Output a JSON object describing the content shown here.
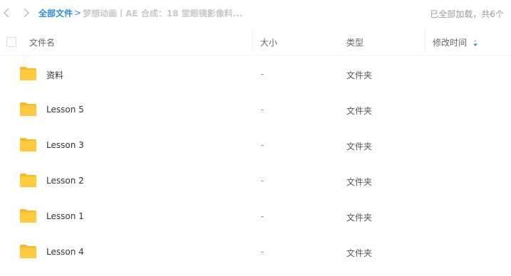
{
  "breadcrumb": {
    "root": "全部文件",
    "separator": ">",
    "current": "梦想动画丨AE 合成：18 堂眼镜影像料..."
  },
  "status": "已全部加载，共6个",
  "columns": {
    "name": "文件名",
    "size": "大小",
    "type": "类型",
    "modified": "修改时间"
  },
  "files": [
    {
      "name": "资料",
      "size": "-",
      "type": "文件夹",
      "icon": "folder-icon"
    },
    {
      "name": "Lesson 5",
      "size": "-",
      "type": "文件夹",
      "icon": "folder-icon"
    },
    {
      "name": "Lesson 3",
      "size": "-",
      "type": "文件夹",
      "icon": "folder-icon"
    },
    {
      "name": "Lesson 2",
      "size": "-",
      "type": "文件夹",
      "icon": "folder-icon"
    },
    {
      "name": "Lesson 1",
      "size": "-",
      "type": "文件夹",
      "icon": "folder-icon"
    },
    {
      "name": "Lesson 4",
      "size": "-",
      "type": "文件夹",
      "icon": "folder-icon"
    }
  ],
  "colors": {
    "accent": "#2b8be0",
    "folder": "#ffc83d"
  }
}
